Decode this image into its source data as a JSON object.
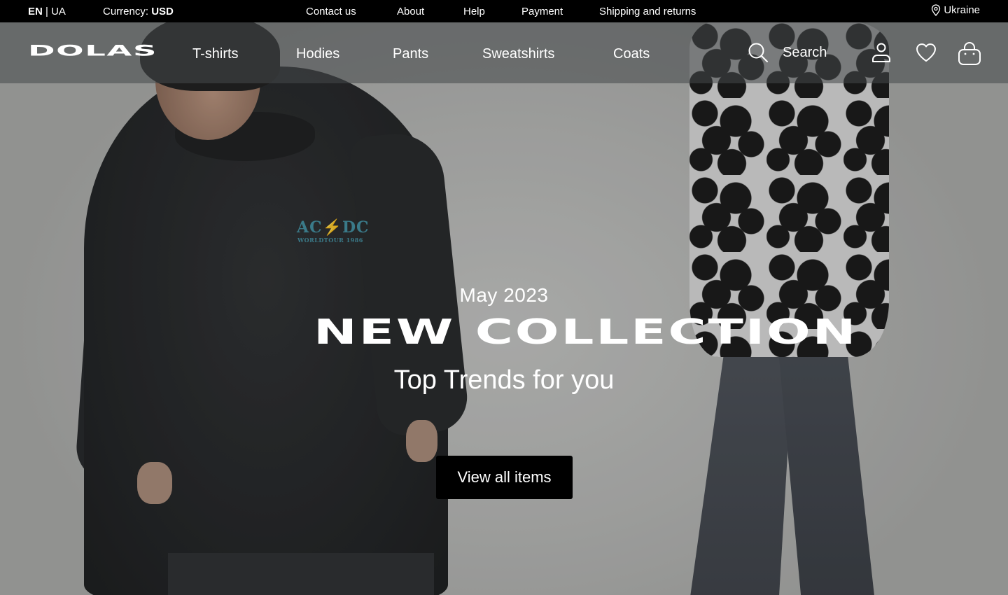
{
  "topbar": {
    "lang_active": "EN",
    "lang_separator": "|",
    "lang_other": "UA",
    "currency_label": "Currency:",
    "currency_value": "USD",
    "links": [
      "Contact us",
      "About",
      "Help",
      "Payment",
      "Shipping and returns"
    ],
    "location": "Ukraine",
    "location_icon": "map-pin-icon"
  },
  "nav": {
    "logo": "DOLAS",
    "links": [
      "T-shirts",
      "Hodies",
      "Pants",
      "Sweatshirts",
      "Coats"
    ],
    "search_label": "Search",
    "icons": [
      "search-icon",
      "user-icon",
      "heart-icon",
      "bag-icon"
    ]
  },
  "hero": {
    "eyebrow": "May 2023",
    "headline": "NEW COLLECTION",
    "subline": "Top Trends for you",
    "cta_label": "View all items",
    "shirt_print_big": "AC⚡DC",
    "shirt_print_small": "WORLDTOUR 1986"
  },
  "colors": {
    "topbar_bg": "#000000",
    "nav_overlay": "#46484a",
    "cta_bg": "#000000",
    "text": "#ffffff"
  }
}
